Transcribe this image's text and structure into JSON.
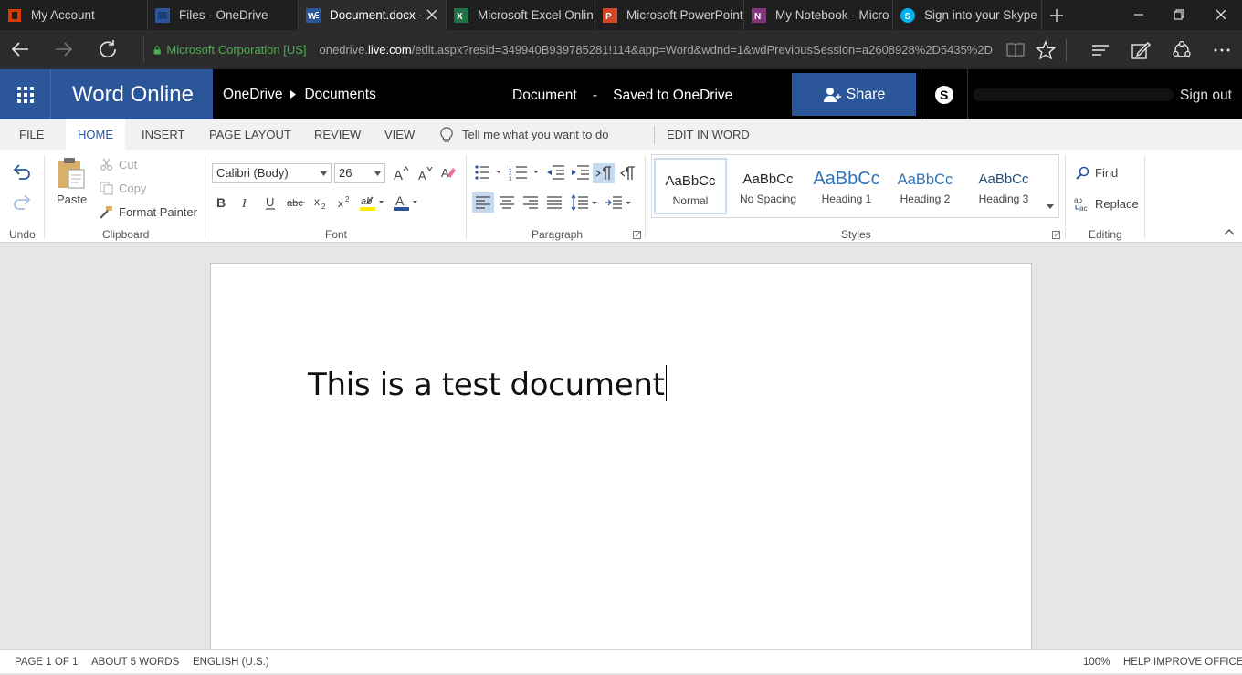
{
  "browser": {
    "tabs": [
      {
        "title": "My Account",
        "icon": "office-icon"
      },
      {
        "title": "Files - OneDrive",
        "icon": "onedrive-icon"
      },
      {
        "title": "Document.docx -",
        "icon": "word-icon",
        "active": true
      },
      {
        "title": "Microsoft Excel Onlin",
        "icon": "excel-icon"
      },
      {
        "title": "Microsoft PowerPoint",
        "icon": "powerpoint-icon"
      },
      {
        "title": "My Notebook - Micro",
        "icon": "onenote-icon"
      },
      {
        "title": "Sign into your Skype",
        "icon": "skype-icon"
      }
    ],
    "certificate": "Microsoft Corporation [US]",
    "url_prefix": "onedrive.",
    "url_host": "live.com",
    "url_path": "/edit.aspx?resid=349940B939785281!114&app=Word&wdnd=1&wdPreviousSession=a2608928%2D5435%2D"
  },
  "app": {
    "name": "Word Online",
    "breadcrumb": [
      "OneDrive",
      "Documents"
    ],
    "doc_name": "Document",
    "doc_separator": "-",
    "save_status": "Saved to OneDrive",
    "share_label": "Share",
    "signout_label": "Sign out"
  },
  "ribbon_tabs": [
    "FILE",
    "HOME",
    "INSERT",
    "PAGE LAYOUT",
    "REVIEW",
    "VIEW"
  ],
  "active_tab": "HOME",
  "tell_me": "Tell me what you want to do",
  "edit_in_word": "EDIT IN WORD",
  "ribbon": {
    "undo_group": "Undo",
    "clipboard": {
      "label": "Clipboard",
      "paste": "Paste",
      "cut": "Cut",
      "copy": "Copy",
      "format_painter": "Format Painter"
    },
    "font": {
      "label": "Font",
      "name": "Calibri (Body)",
      "size": "26"
    },
    "paragraph": {
      "label": "Paragraph"
    },
    "styles": {
      "label": "Styles",
      "items": [
        {
          "preview": "AaBbCc",
          "name": "Normal"
        },
        {
          "preview": "AaBbCc",
          "name": "No Spacing"
        },
        {
          "preview": "AaBbCc",
          "name": "Heading 1"
        },
        {
          "preview": "AaBbCc",
          "name": "Heading 2"
        },
        {
          "preview": "AaBbCc",
          "name": "Heading 3"
        }
      ]
    },
    "editing": {
      "label": "Editing",
      "find": "Find",
      "replace": "Replace"
    }
  },
  "document": {
    "text": "This is a test document"
  },
  "status": {
    "page": "PAGE 1 OF 1",
    "words": "ABOUT 5 WORDS",
    "language": "ENGLISH (U.S.)",
    "zoom": "100%",
    "help": "HELP IMPROVE OFFICE"
  },
  "colors": {
    "word_blue": "#2b579a",
    "accent": "#2b579a"
  }
}
